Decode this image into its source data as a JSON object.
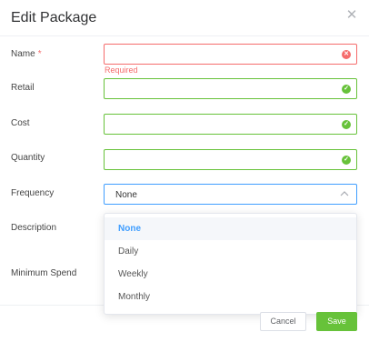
{
  "dialog": {
    "title": "Edit Package",
    "close_icon": "close-icon"
  },
  "fields": {
    "name": {
      "label": "Name",
      "required_mark": "*",
      "value": "",
      "status": "error-icon",
      "error": "Required"
    },
    "retail": {
      "label": "Retail",
      "value": "",
      "status": "check-icon"
    },
    "cost": {
      "label": "Cost",
      "value": "",
      "status": "check-icon"
    },
    "quantity": {
      "label": "Quantity",
      "value": "",
      "status": "check-icon"
    },
    "frequency": {
      "label": "Frequency",
      "value": "None",
      "icon": "chevron-up-icon"
    },
    "description": {
      "label": "Description"
    },
    "minimum_spend": {
      "label": "Minimum Spend"
    }
  },
  "frequency_options": [
    "None",
    "Daily",
    "Weekly",
    "Monthly"
  ],
  "frequency_selected": "None",
  "footer": {
    "cancel_label": "Cancel",
    "save_label": "Save"
  },
  "colors": {
    "success": "#67c23a",
    "error": "#f56c6c",
    "accent": "#409eff"
  }
}
